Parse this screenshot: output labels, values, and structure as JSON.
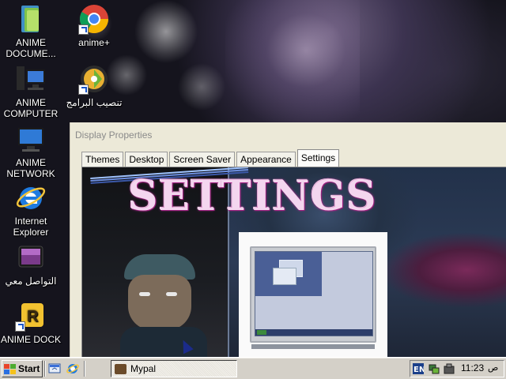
{
  "desktop": {
    "icons": [
      {
        "label": "ANIME DOCUME...",
        "icon": "documents-folder-icon"
      },
      {
        "label": "anime+",
        "icon": "chrome-icon"
      },
      {
        "label": "ANIME COMPUTER",
        "icon": "computer-icon"
      },
      {
        "label": "تنصيب البرامج",
        "icon": "installer-icon"
      },
      {
        "label": "ANIME NETWORK",
        "icon": "network-icon"
      },
      {
        "label": "Internet Explorer",
        "icon": "internet-explorer-icon"
      },
      {
        "label": "التواصل معي",
        "icon": "contact-icon"
      },
      {
        "label": "ANIME DOCK",
        "icon": "dock-icon"
      }
    ]
  },
  "dialog": {
    "title": "Display Properties",
    "tabs": [
      {
        "label": "Themes"
      },
      {
        "label": "Desktop"
      },
      {
        "label": "Screen Saver"
      },
      {
        "label": "Appearance"
      },
      {
        "label": "Settings",
        "active": true
      }
    ],
    "banner_text": "SETTINGS"
  },
  "taskbar": {
    "start_label": "Start",
    "quick_launch": [
      "show-desktop-icon",
      "internet-explorer-quick-icon"
    ],
    "task_label": "Mypal",
    "tray_icons": [
      "language-indicator-icon",
      "network-tray-icon",
      "safely-remove-icon"
    ],
    "clock": "11:23",
    "ampm": "ص"
  },
  "colors": {
    "taskbar_bg": "#d4d0c8",
    "dialog_bg": "#ece9d8",
    "banner_pink": "#c02a9a"
  }
}
